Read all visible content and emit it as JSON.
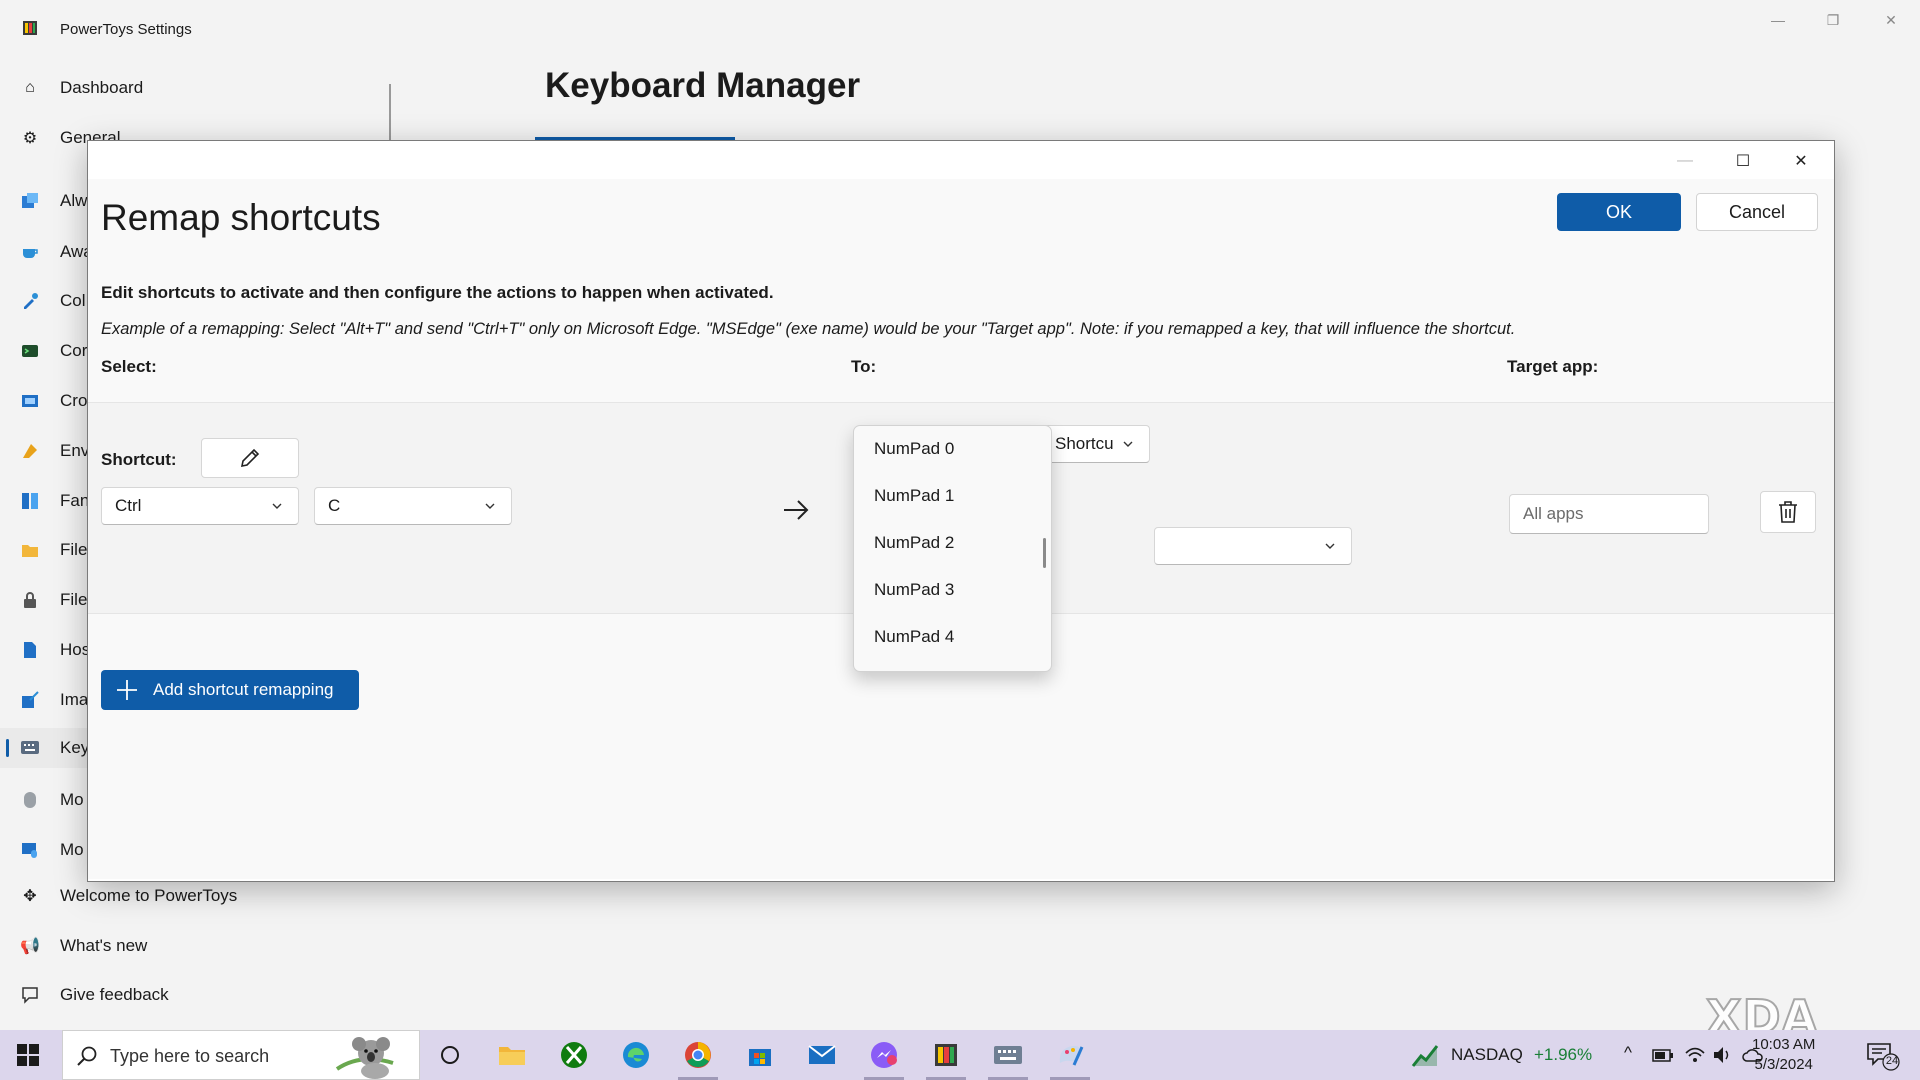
{
  "app": {
    "title": "PowerToys Settings",
    "page_heading": "Keyboard Manager"
  },
  "nav": {
    "items": [
      {
        "label": "Dashboard",
        "icon": "home-icon"
      },
      {
        "label": "General",
        "icon": "gear-icon"
      },
      {
        "label": "Alw",
        "icon": "always-on-top-icon"
      },
      {
        "label": "Awa",
        "icon": "awake-icon"
      },
      {
        "label": "Col",
        "icon": "color-picker-icon"
      },
      {
        "label": "Cor",
        "icon": "command-not-found-icon"
      },
      {
        "label": "Cro",
        "icon": "crop-and-lock-icon"
      },
      {
        "label": "Env",
        "icon": "environment-variables-icon"
      },
      {
        "label": "Fan",
        "icon": "fancyzones-icon"
      },
      {
        "label": "File",
        "icon": "file-explorer-addons-icon"
      },
      {
        "label": "File",
        "icon": "file-locksmith-icon"
      },
      {
        "label": "Hos",
        "icon": "hosts-editor-icon"
      },
      {
        "label": "Ima",
        "icon": "image-resizer-icon"
      },
      {
        "label": "Key",
        "icon": "keyboard-icon"
      },
      {
        "label": "Mo",
        "icon": "mouse-utilities-icon"
      },
      {
        "label": "Mo",
        "icon": "mouse-without-borders-icon"
      }
    ],
    "footer": [
      {
        "label": "Welcome to PowerToys",
        "icon": "welcome-icon"
      },
      {
        "label": "What's new",
        "icon": "megaphone-icon"
      },
      {
        "label": "Give feedback",
        "icon": "feedback-icon"
      }
    ]
  },
  "dialog": {
    "title": "Remap shortcuts",
    "ok_label": "OK",
    "cancel_label": "Cancel",
    "description": "Edit shortcuts to activate and then configure the actions to happen when activated.",
    "example": "Example of a remapping: Select \"Alt+T\" and send \"Ctrl+T\" only on Microsoft Edge. \"MSEdge\" (exe name) would be your \"Target app\". Note: if you remapped a key, that will influence the shortcut.",
    "col_select": "Select:",
    "col_to": "To:",
    "col_target": "Target app:",
    "row": {
      "shortcut_label": "Shortcut:",
      "key1": "Ctrl",
      "key2": "C",
      "action_type": "Shortcu",
      "target_placeholder": "All apps"
    },
    "add_label": "Add shortcut remapping",
    "popup_items": [
      "NumPad 0",
      "NumPad 1",
      "NumPad 2",
      "NumPad 3",
      "NumPad 4"
    ]
  },
  "taskbar": {
    "search_placeholder": "Type here to search",
    "stock_name": "NASDAQ",
    "stock_change": "+1.96%",
    "time": "10:03 AM",
    "date": "5/3/2024",
    "notification_count": "24"
  },
  "watermark": "XDA",
  "colors": {
    "accent": "#0f5ca8",
    "stock_positive": "#1a7f37",
    "taskbar": "#dcd6ec"
  }
}
